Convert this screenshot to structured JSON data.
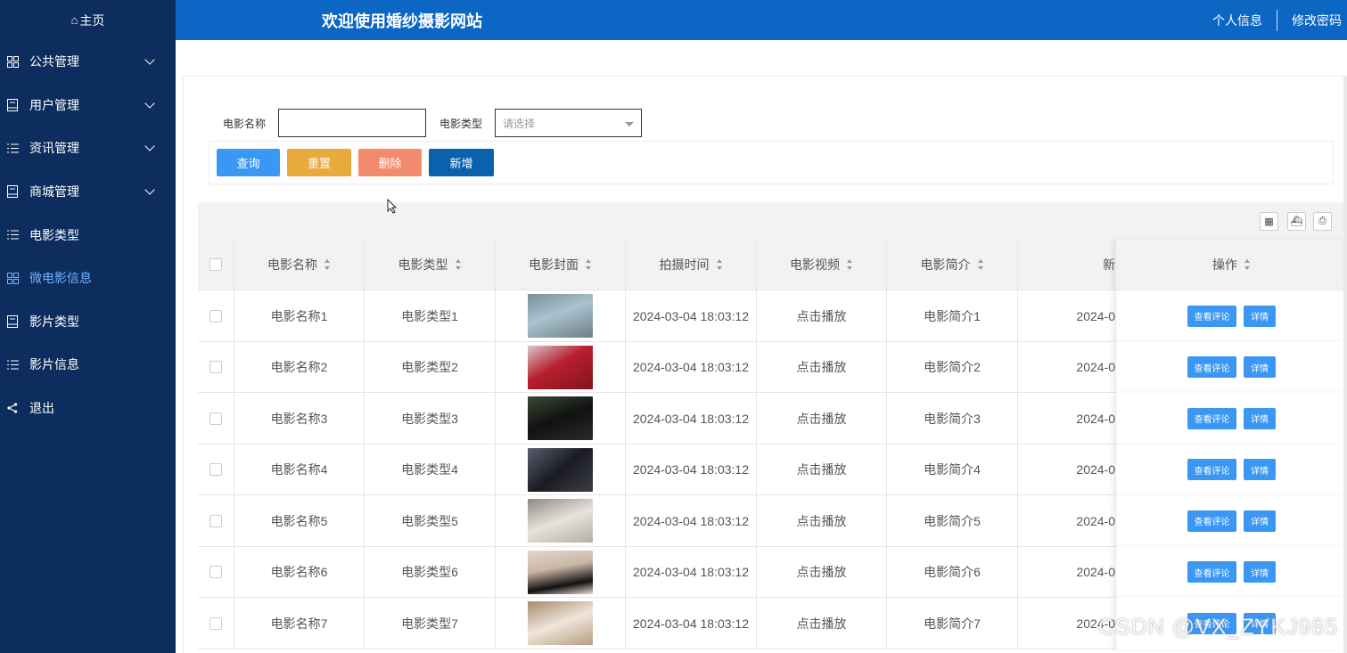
{
  "sidebar": {
    "home_label": "主页",
    "items": [
      {
        "label": "公共管理",
        "icon": "grid-icon",
        "expandable": true
      },
      {
        "label": "用户管理",
        "icon": "book-icon",
        "expandable": true
      },
      {
        "label": "资讯管理",
        "icon": "list-icon",
        "expandable": true
      },
      {
        "label": "商城管理",
        "icon": "book-icon",
        "expandable": true
      },
      {
        "label": "电影类型",
        "icon": "list-icon",
        "expandable": false
      },
      {
        "label": "微电影信息",
        "icon": "grid-icon",
        "expandable": false,
        "active": true
      },
      {
        "label": "影片类型",
        "icon": "book-icon",
        "expandable": false
      },
      {
        "label": "影片信息",
        "icon": "list-icon",
        "expandable": false
      },
      {
        "label": "退出",
        "icon": "share-icon",
        "expandable": false
      }
    ]
  },
  "header": {
    "title": "欢迎使用婚纱摄影网站",
    "profile_link": "个人信息",
    "password_link": "修改密码"
  },
  "search": {
    "name_label": "电影名称",
    "name_value": "",
    "type_label": "电影类型",
    "type_placeholder": "请选择"
  },
  "buttons": {
    "query": "查询",
    "reset": "重置",
    "delete": "删除",
    "add": "新增"
  },
  "colors": {
    "sidebar_bg": "#0d2d5e",
    "header_bg": "#0c66c3",
    "query_btn": "#3a97f3",
    "reset_btn": "#e8a93d",
    "delete_btn": "#f28a6e",
    "add_btn": "#0a62ae",
    "active_menu": "#6fb1ff"
  },
  "table": {
    "columns": [
      "电影名称",
      "电影类型",
      "电影封面",
      "拍摄时间",
      "电影视频",
      "电影简介",
      "新"
    ],
    "ops_header": "操作",
    "rows": [
      {
        "name": "电影名称1",
        "type": "电影类型1",
        "time": "2024-03-04 18:03:12",
        "video": "点击播放",
        "intro": "电影简介1",
        "trunc": "2024-0",
        "cover": "linear-gradient(160deg,#7c8e99 0%,#a9c3cf 45%,#6e7f84 100%)"
      },
      {
        "name": "电影名称2",
        "type": "电影类型2",
        "time": "2024-03-04 18:03:12",
        "video": "点击播放",
        "intro": "电影简介2",
        "trunc": "2024-0",
        "cover": "linear-gradient(150deg,#d8c6cb 0%,#b81f2e 45%,#7f1320 100%)"
      },
      {
        "name": "电影名称3",
        "type": "电影类型3",
        "time": "2024-03-04 18:03:12",
        "video": "点击播放",
        "intro": "电影简介3",
        "trunc": "2024-0",
        "cover": "linear-gradient(160deg,#3a4a33 0%,#111 50%,#2b2b2b 100%)"
      },
      {
        "name": "电影名称4",
        "type": "电影类型4",
        "time": "2024-03-04 18:03:12",
        "video": "点击播放",
        "intro": "电影简介4",
        "trunc": "2024-0",
        "cover": "linear-gradient(140deg,#5b5f6e 0%,#1a1b22 50%,#3c3e46 100%)"
      },
      {
        "name": "电影名称5",
        "type": "电影类型5",
        "time": "2024-03-04 18:03:12",
        "video": "点击播放",
        "intro": "电影简介5",
        "trunc": "2024-0",
        "cover": "linear-gradient(160deg,#8d8a83 0%,#e7e3dc 50%,#b3afa7 100%)"
      },
      {
        "name": "电影名称6",
        "type": "电影类型6",
        "time": "2024-03-04 18:03:12",
        "video": "点击播放",
        "intro": "电影简介6",
        "trunc": "2024-0",
        "cover": "linear-gradient(170deg,#e4d6cb 0%,#c9b6a6 40%,#111 75%,#e6dcd2 100%)"
      },
      {
        "name": "电影名称7",
        "type": "电影类型7",
        "time": "2024-03-04 18:03:12",
        "video": "点击播放",
        "intro": "电影简介7",
        "trunc": "2024-0",
        "cover": "linear-gradient(160deg,#a58a6c 0%,#efe6da 50%,#b79d80 100%)"
      }
    ],
    "row_actions": {
      "comments": "查看评论",
      "detail": "详情"
    }
  },
  "watermark": "CSDN @VX_ZYKJ985"
}
